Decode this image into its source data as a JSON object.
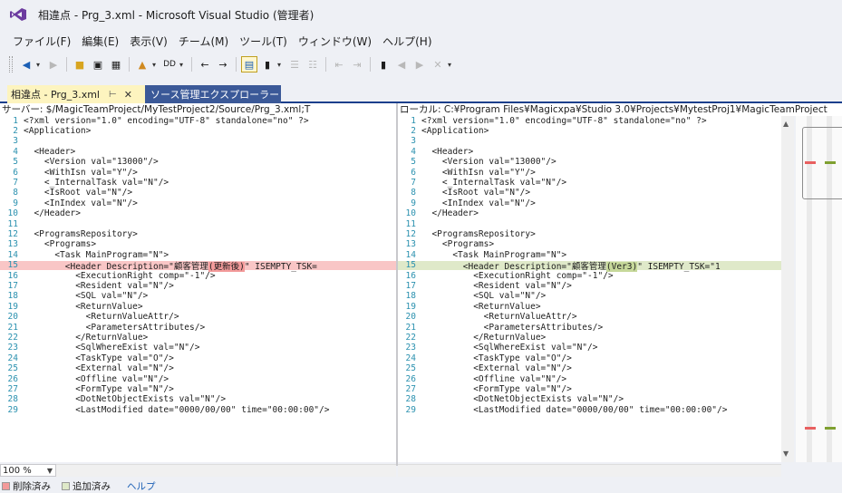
{
  "window": {
    "title": "相違点 - Prg_3.xml - Microsoft Visual Studio (管理者)"
  },
  "menu": {
    "items": [
      "ファイル(F)",
      "編集(E)",
      "表示(V)",
      "チーム(M)",
      "ツール(T)",
      "ウィンドウ(W)",
      "ヘルプ(H)"
    ]
  },
  "toolbar": {
    "buttons": [
      "back-icon",
      "forward-icon",
      "open-folder-icon",
      "save-icon",
      "save-all-icon",
      "compare-icon",
      "view-mode-icon",
      "nav-left-icon",
      "nav-right-icon",
      "side-by-side-icon",
      "inline-icon",
      "split-icon",
      "options-icon",
      "outdent-icon",
      "indent-icon",
      "bookmark-icon"
    ]
  },
  "tabs": {
    "active": {
      "label": "相違点 - Prg_3.xml"
    },
    "inactive": {
      "label": "ソース管理エクスプローラー"
    }
  },
  "left_pane": {
    "header": "サーバー: $/MagicTeamProject/MyTestProject2/Source/Prg_3.xml;T",
    "lines": [
      "<?xml version=\"1.0\" encoding=\"UTF-8\" standalone=\"no\" ?>",
      "<Application>",
      "",
      "  <Header>",
      "    <Version val=\"13000\"/>",
      "    <WithIsn val=\"Y\"/>",
      "    <_InternalTask val=\"N\"/>",
      "    <IsRoot val=\"N\"/>",
      "    <InIndex val=\"N\"/>",
      "  </Header>",
      "",
      "  <ProgramsRepository>",
      "    <Programs>",
      "      <Task MainProgram=\"N\">",
      "        <Header Description=\"顧客管理(更新後)\" ISEMPTY_TSK=",
      "          <ExecutionRight comp=\"-1\"/>",
      "          <Resident val=\"N\"/>",
      "          <SQL val=\"N\"/>",
      "          <ReturnValue>",
      "            <ReturnValueAttr/>",
      "            <ParametersAttributes/>",
      "          </ReturnValue>",
      "          <SqlWhereExist val=\"N\"/>",
      "          <TaskType val=\"O\"/>",
      "          <External val=\"N\"/>",
      "          <Offline val=\"N\"/>",
      "          <FormType val=\"N\"/>",
      "          <DotNetObjectExists val=\"N\"/>",
      "          <LastModified date=\"0000/00/00\" time=\"00:00:00\"/>"
    ],
    "changed_line": 15,
    "changed_prefix": "        <Header Description=\"顧客管理",
    "changed_word": "(更新後)",
    "changed_suffix": "\" ISEMPTY_TSK="
  },
  "right_pane": {
    "header": "ローカル: C:¥Program Files¥Magicxpa¥Studio 3.0¥Projects¥MytestProj1¥MagicTeamProject",
    "lines": [
      "<?xml version=\"1.0\" encoding=\"UTF-8\" standalone=\"no\" ?>",
      "<Application>",
      "",
      "  <Header>",
      "    <Version val=\"13000\"/>",
      "    <WithIsn val=\"Y\"/>",
      "    <_InternalTask val=\"N\"/>",
      "    <IsRoot val=\"N\"/>",
      "    <InIndex val=\"N\"/>",
      "  </Header>",
      "",
      "  <ProgramsRepository>",
      "    <Programs>",
      "      <Task MainProgram=\"N\">",
      "        <Header Description=\"顧客管理(Ver3)\" ISEMPTY_TSK=\"1",
      "          <ExecutionRight comp=\"-1\"/>",
      "          <Resident val=\"N\"/>",
      "          <SQL val=\"N\"/>",
      "          <ReturnValue>",
      "            <ReturnValueAttr/>",
      "            <ParametersAttributes/>",
      "          </ReturnValue>",
      "          <SqlWhereExist val=\"N\"/>",
      "          <TaskType val=\"O\"/>",
      "          <External val=\"N\"/>",
      "          <Offline val=\"N\"/>",
      "          <FormType val=\"N\"/>",
      "          <DotNetObjectExists val=\"N\"/>",
      "          <LastModified date=\"0000/00/00\" time=\"00:00:00\"/>"
    ],
    "changed_line": 15,
    "changed_prefix": "        <Header Description=\"顧客管理",
    "changed_word": "(Ver3)",
    "changed_suffix": "\" ISEMPTY_TSK=\"1"
  },
  "status": {
    "zoom": "100 %",
    "legend_deleted": "削除済み",
    "legend_added": "追加済み",
    "help": "ヘルプ"
  },
  "colors": {
    "deleted_line": "#f9c6c6",
    "deleted_word": "#f39a9a",
    "added_line": "#dfe9c9",
    "added_word": "#c6d89a",
    "tab_active": "#fdf4bf",
    "tab_inactive": "#3b5998",
    "line_numbers": "#2b91af"
  }
}
